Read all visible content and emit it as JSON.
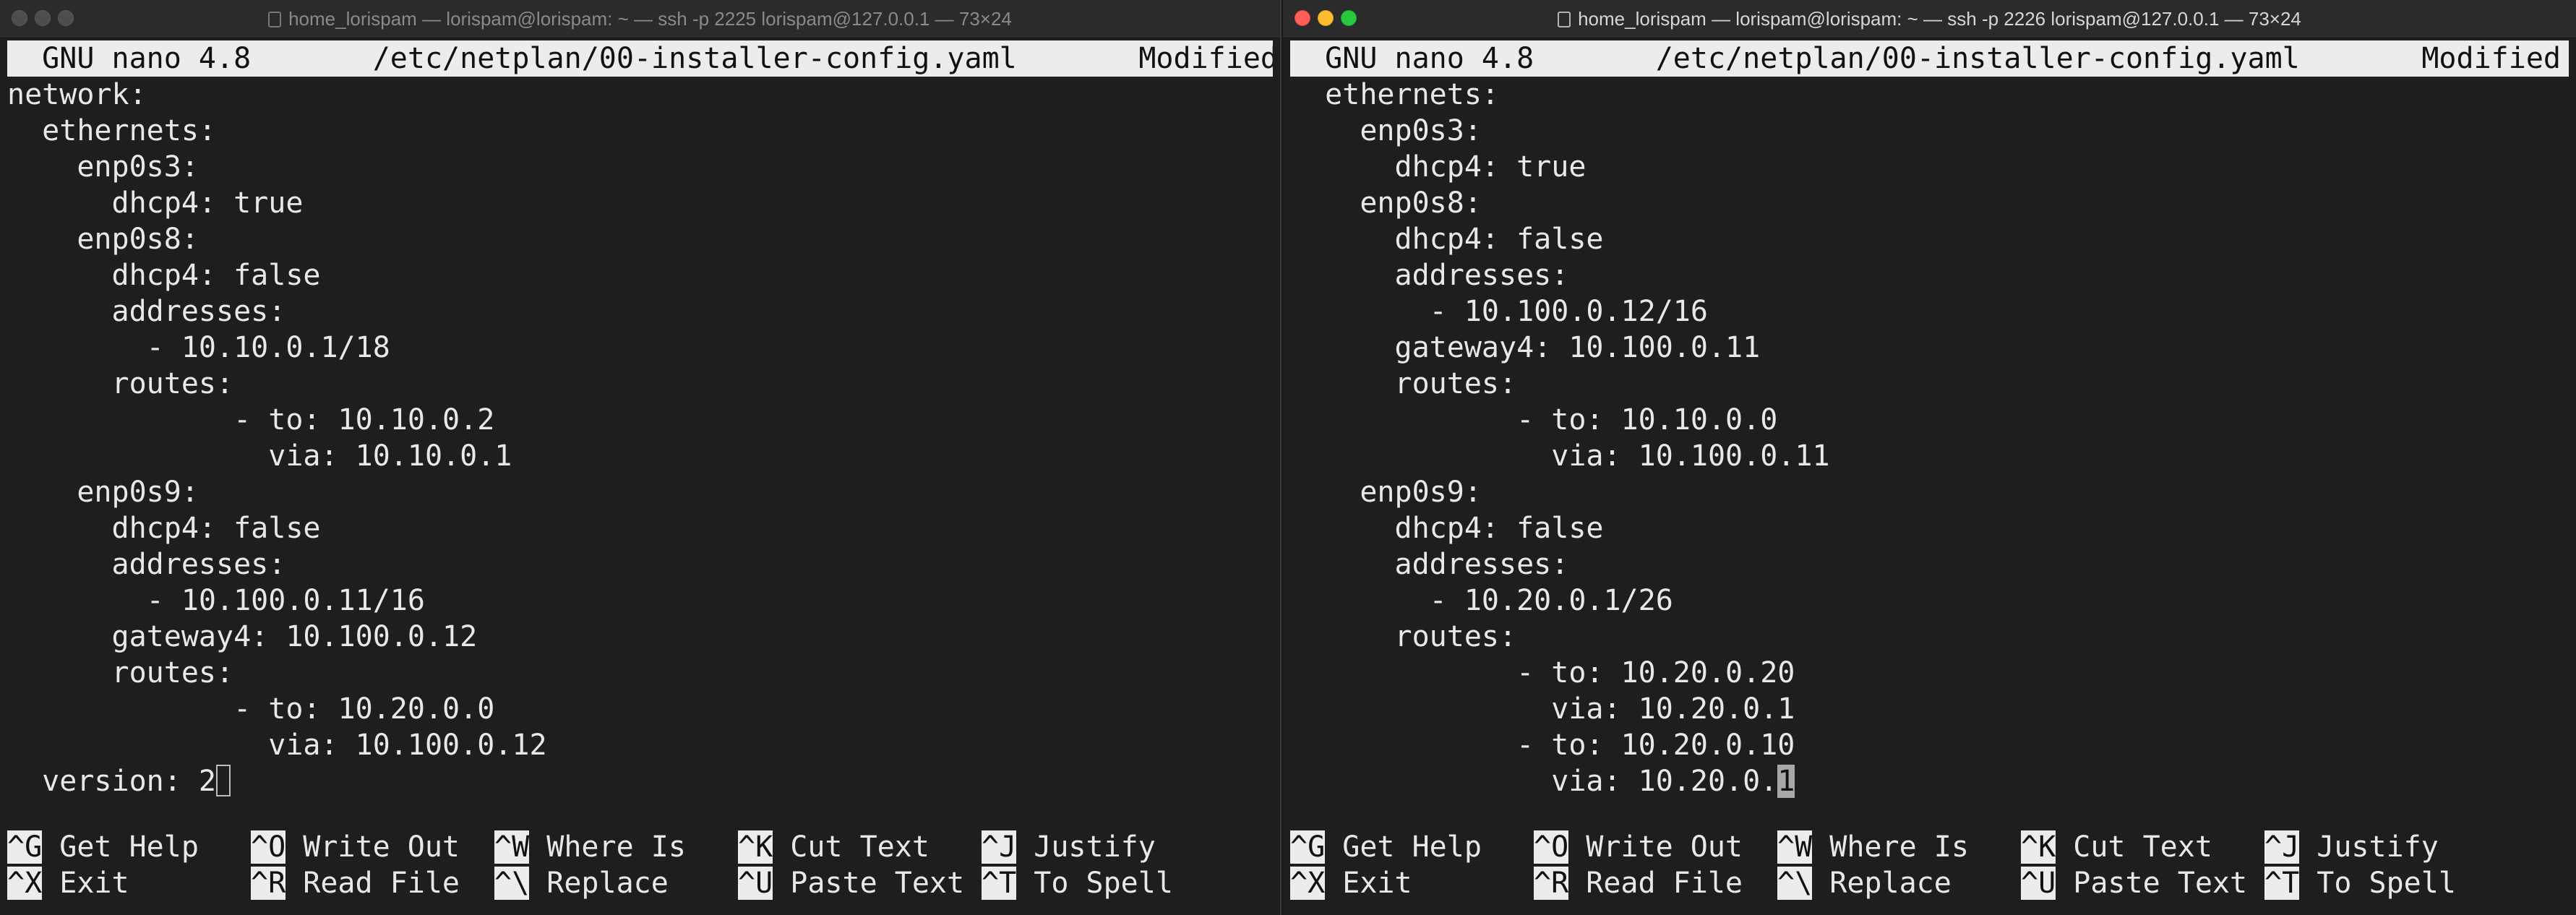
{
  "windows": {
    "left": {
      "title": "home_lorispam — lorispam@lorispam: ~ — ssh -p 2225 lorispam@127.0.0.1 — 73×24",
      "header": "  GNU nano 4.8       /etc/netplan/00-installer-config.yaml       Modified  ",
      "lines": [
        "network:",
        "  ethernets:",
        "    enp0s3:",
        "      dhcp4: true",
        "    enp0s8:",
        "      dhcp4: false",
        "      addresses:",
        "        - 10.10.0.1/18",
        "      routes:",
        "             - to: 10.10.0.2",
        "               via: 10.10.0.1",
        "    enp0s9:",
        "      dhcp4: false",
        "      addresses:",
        "        - 10.100.0.11/16",
        "      gateway4: 10.100.0.12",
        "      routes:",
        "             - to: 10.20.0.0",
        "               via: 10.100.0.12"
      ],
      "last_line": "  version: 2"
    },
    "right": {
      "title": "home_lorispam — lorispam@lorispam: ~ — ssh -p 2226 lorispam@127.0.0.1 — 73×24",
      "header": "  GNU nano 4.8       /etc/netplan/00-installer-config.yaml       Modified  ",
      "lines": [
        "  ethernets:",
        "    enp0s3:",
        "      dhcp4: true",
        "    enp0s8:",
        "      dhcp4: false",
        "      addresses:",
        "        - 10.100.0.12/16",
        "      gateway4: 10.100.0.11",
        "      routes:",
        "             - to: 10.10.0.0",
        "               via: 10.100.0.11",
        "    enp0s9:",
        "      dhcp4: false",
        "      addresses:",
        "        - 10.20.0.1/26",
        "      routes:",
        "             - to: 10.20.0.20",
        "               via: 10.20.0.1",
        "             - to: 10.20.0.10"
      ],
      "last_line_prefix": "               via: 10.20.0.",
      "last_line_cursor_char": "1"
    }
  },
  "shortcuts": {
    "row1": [
      {
        "key": "^G",
        "label": " Get Help"
      },
      {
        "key": "^O",
        "label": " Write Out"
      },
      {
        "key": "^W",
        "label": " Where Is"
      },
      {
        "key": "^K",
        "label": " Cut Text"
      },
      {
        "key": "^J",
        "label": " Justify"
      }
    ],
    "row2": [
      {
        "key": "^X",
        "label": " Exit"
      },
      {
        "key": "^R",
        "label": " Read File"
      },
      {
        "key": "^\\",
        "label": " Replace"
      },
      {
        "key": "^U",
        "label": " Paste Text"
      },
      {
        "key": "^T",
        "label": " To Spell"
      }
    ]
  },
  "colors": {
    "terminal_bg": "#1e1e1e",
    "text": "#e8e8e8",
    "inverse_bg": "#ececec"
  }
}
